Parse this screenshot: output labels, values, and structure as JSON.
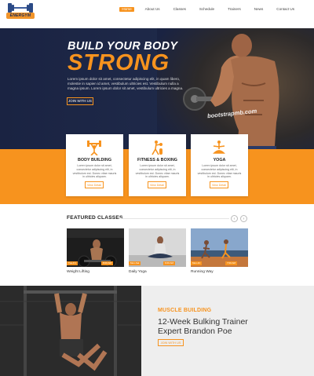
{
  "brand": {
    "logo_text": "ENERGYM",
    "accent": "#f7931e",
    "navy": "#1a2342"
  },
  "nav": {
    "items": [
      {
        "label": "Home",
        "active": true
      },
      {
        "label": "About Us"
      },
      {
        "label": "Classes"
      },
      {
        "label": "Schedule"
      },
      {
        "label": "Trainers"
      },
      {
        "label": "News"
      },
      {
        "label": "Contact Us"
      }
    ]
  },
  "hero": {
    "subtitle": "BUILD YOUR BODY",
    "title": "STRONG",
    "text": "Lorem ipsum dolor sit amet, consectetur adipiscing elit, in quam libero, molestie in sapien id amet, vestibulum ultricies est. Vestibulum nulla a magna ipsum. Lorem ipsum dolor sit amet, vestibulum ultricies a magna.",
    "button": "JOIN WITH US",
    "watermark": "bootstrapmb.com"
  },
  "services": [
    {
      "title": "BODY BUILDING",
      "icon": "weightlifter-icon",
      "text": "Lorem ipsum dolor sit amet, consectetur adipiscing elit, in vestibulum est. Donec vitae mauris in ultricies aliquam.",
      "button": "View Detail"
    },
    {
      "title": "FITNESS & BOXING",
      "icon": "boxing-icon",
      "text": "Lorem ipsum dolor sit amet, consectetur adipiscing elit, in vestibulum est. Donec vitae mauris in ultricies aliquam.",
      "button": "View Detail"
    },
    {
      "title": "YOGA",
      "icon": "yoga-icon",
      "text": "Lorem ipsum dolor sit amet, consectetur adipiscing elit, in vestibulum est. Donec vitae mauris in ultricies aliquam.",
      "button": "View Detail"
    }
  ],
  "featured": {
    "heading": "FEATURED CLASSES",
    "prev_icon": "chevron-left-icon",
    "next_icon": "chevron-right-icon",
    "classes": [
      {
        "name": "Weight Lifting",
        "tag1": "Tue-Fri",
        "tag2": "8:00 AM"
      },
      {
        "name": "Daily Yoga",
        "tag1": "Mon-Sat",
        "tag2": "6:00 AM"
      },
      {
        "name": "Running Way",
        "tag1": "Mon-Fri",
        "tag2": "7:00 AM"
      }
    ]
  },
  "promo": {
    "label": "MUSCLE BUILDING",
    "line1": "12-Week Bulking Trainer",
    "line2": "Expert Brandon Poe",
    "button": "JOIN WITH US"
  }
}
